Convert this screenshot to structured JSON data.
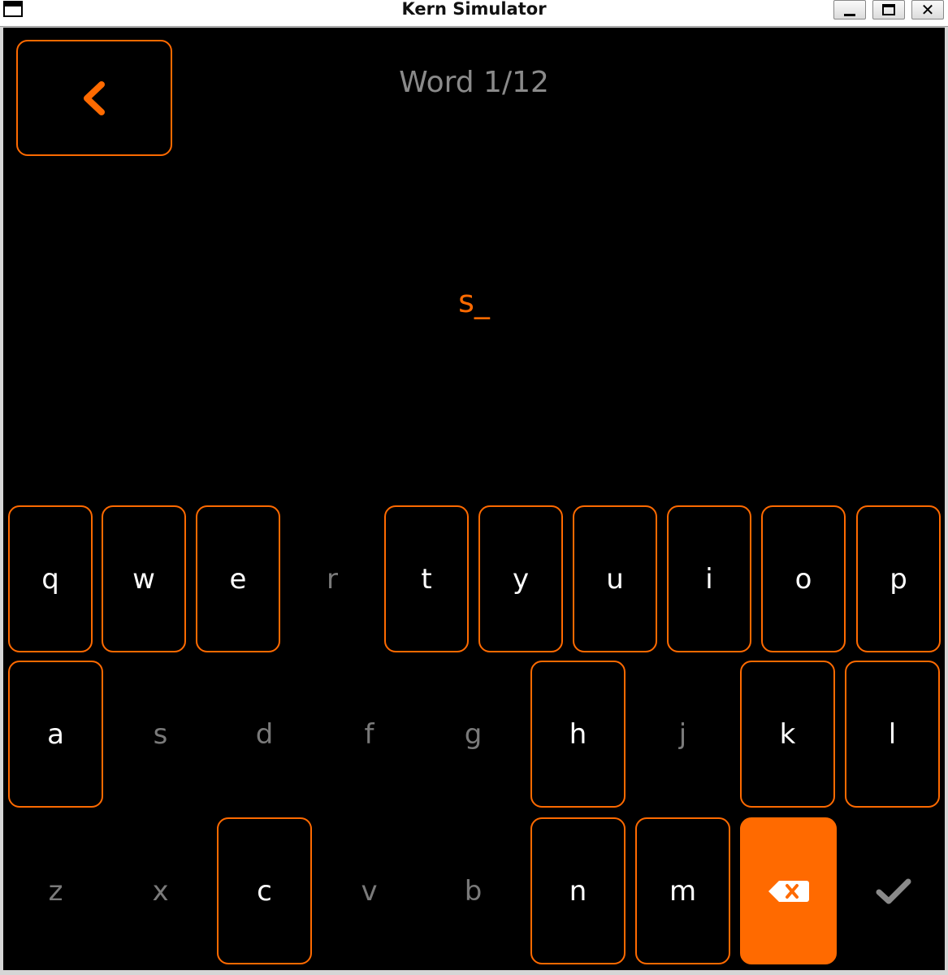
{
  "window": {
    "title": "Kern Simulator"
  },
  "header": {
    "progress": "Word 1/12"
  },
  "entry": {
    "text": "s_"
  },
  "keyboard": {
    "accent": "#ff6a00",
    "row1": [
      {
        "label": "q",
        "enabled": true
      },
      {
        "label": "w",
        "enabled": true
      },
      {
        "label": "e",
        "enabled": true
      },
      {
        "label": "r",
        "enabled": false
      },
      {
        "label": "t",
        "enabled": true
      },
      {
        "label": "y",
        "enabled": true
      },
      {
        "label": "u",
        "enabled": true
      },
      {
        "label": "i",
        "enabled": true
      },
      {
        "label": "o",
        "enabled": true
      },
      {
        "label": "p",
        "enabled": true
      }
    ],
    "row2": [
      {
        "label": "a",
        "enabled": true
      },
      {
        "label": "s",
        "enabled": false
      },
      {
        "label": "d",
        "enabled": false
      },
      {
        "label": "f",
        "enabled": false
      },
      {
        "label": "g",
        "enabled": false
      },
      {
        "label": "h",
        "enabled": true
      },
      {
        "label": "j",
        "enabled": false
      },
      {
        "label": "k",
        "enabled": true
      },
      {
        "label": "l",
        "enabled": true
      }
    ],
    "row3": [
      {
        "label": "z",
        "enabled": false
      },
      {
        "label": "x",
        "enabled": false
      },
      {
        "label": "c",
        "enabled": true
      },
      {
        "label": "v",
        "enabled": false
      },
      {
        "label": "b",
        "enabled": false
      },
      {
        "label": "n",
        "enabled": true
      },
      {
        "label": "m",
        "enabled": true
      }
    ],
    "backspace_icon": "backspace-icon",
    "confirm_icon": "checkmark-icon"
  }
}
